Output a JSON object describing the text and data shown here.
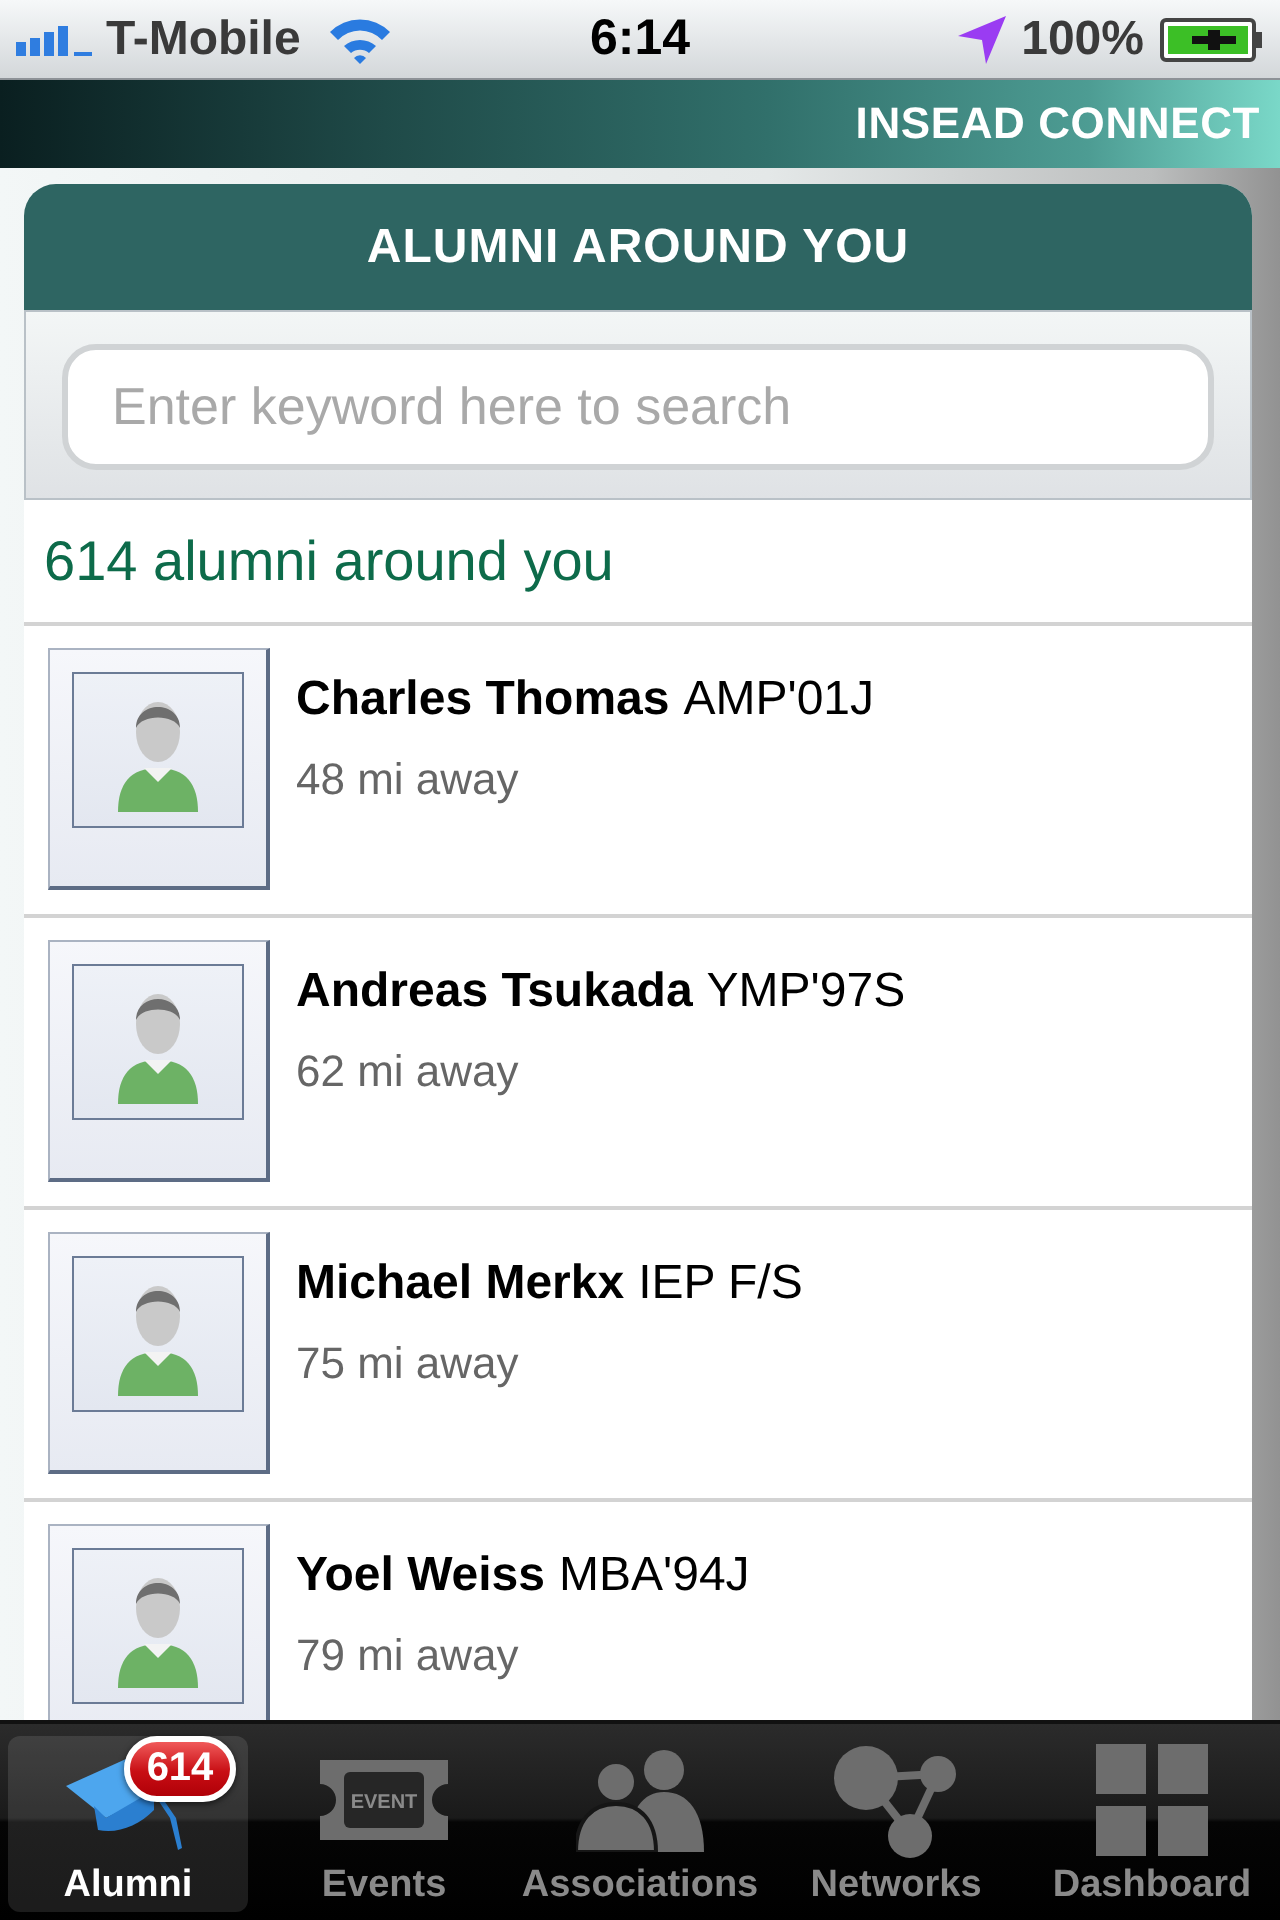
{
  "status_bar": {
    "carrier": "T-Mobile",
    "time": "6:14",
    "battery": "100%"
  },
  "header": {
    "title": "INSEAD CONNECT"
  },
  "panel": {
    "title": "ALUMNI AROUND YOU",
    "search": {
      "placeholder": "Enter keyword here to search"
    },
    "count": "614 alumni around you",
    "alumni": [
      {
        "name": "Charles Thomas",
        "program": "AMP'01J",
        "distance": "48 mi away"
      },
      {
        "name": "Andreas Tsukada",
        "program": "YMP'97S",
        "distance": "62 mi away"
      },
      {
        "name": "Michael Merkx",
        "program": "IEP F/S",
        "distance": "75 mi away"
      },
      {
        "name": "Yoel Weiss",
        "program": "MBA'94J",
        "distance": "79 mi away"
      }
    ]
  },
  "tab_bar": {
    "tabs": [
      {
        "kind": "alumni",
        "label": "Alumni",
        "selected": true,
        "badge": "614"
      },
      {
        "kind": "events",
        "label": "Events",
        "selected": false,
        "icon_text": "EVENT"
      },
      {
        "kind": "associations",
        "label": "Associations",
        "selected": false
      },
      {
        "kind": "networks",
        "label": "Networks",
        "selected": false
      },
      {
        "kind": "dashboard",
        "label": "Dashboard",
        "selected": false
      }
    ]
  }
}
